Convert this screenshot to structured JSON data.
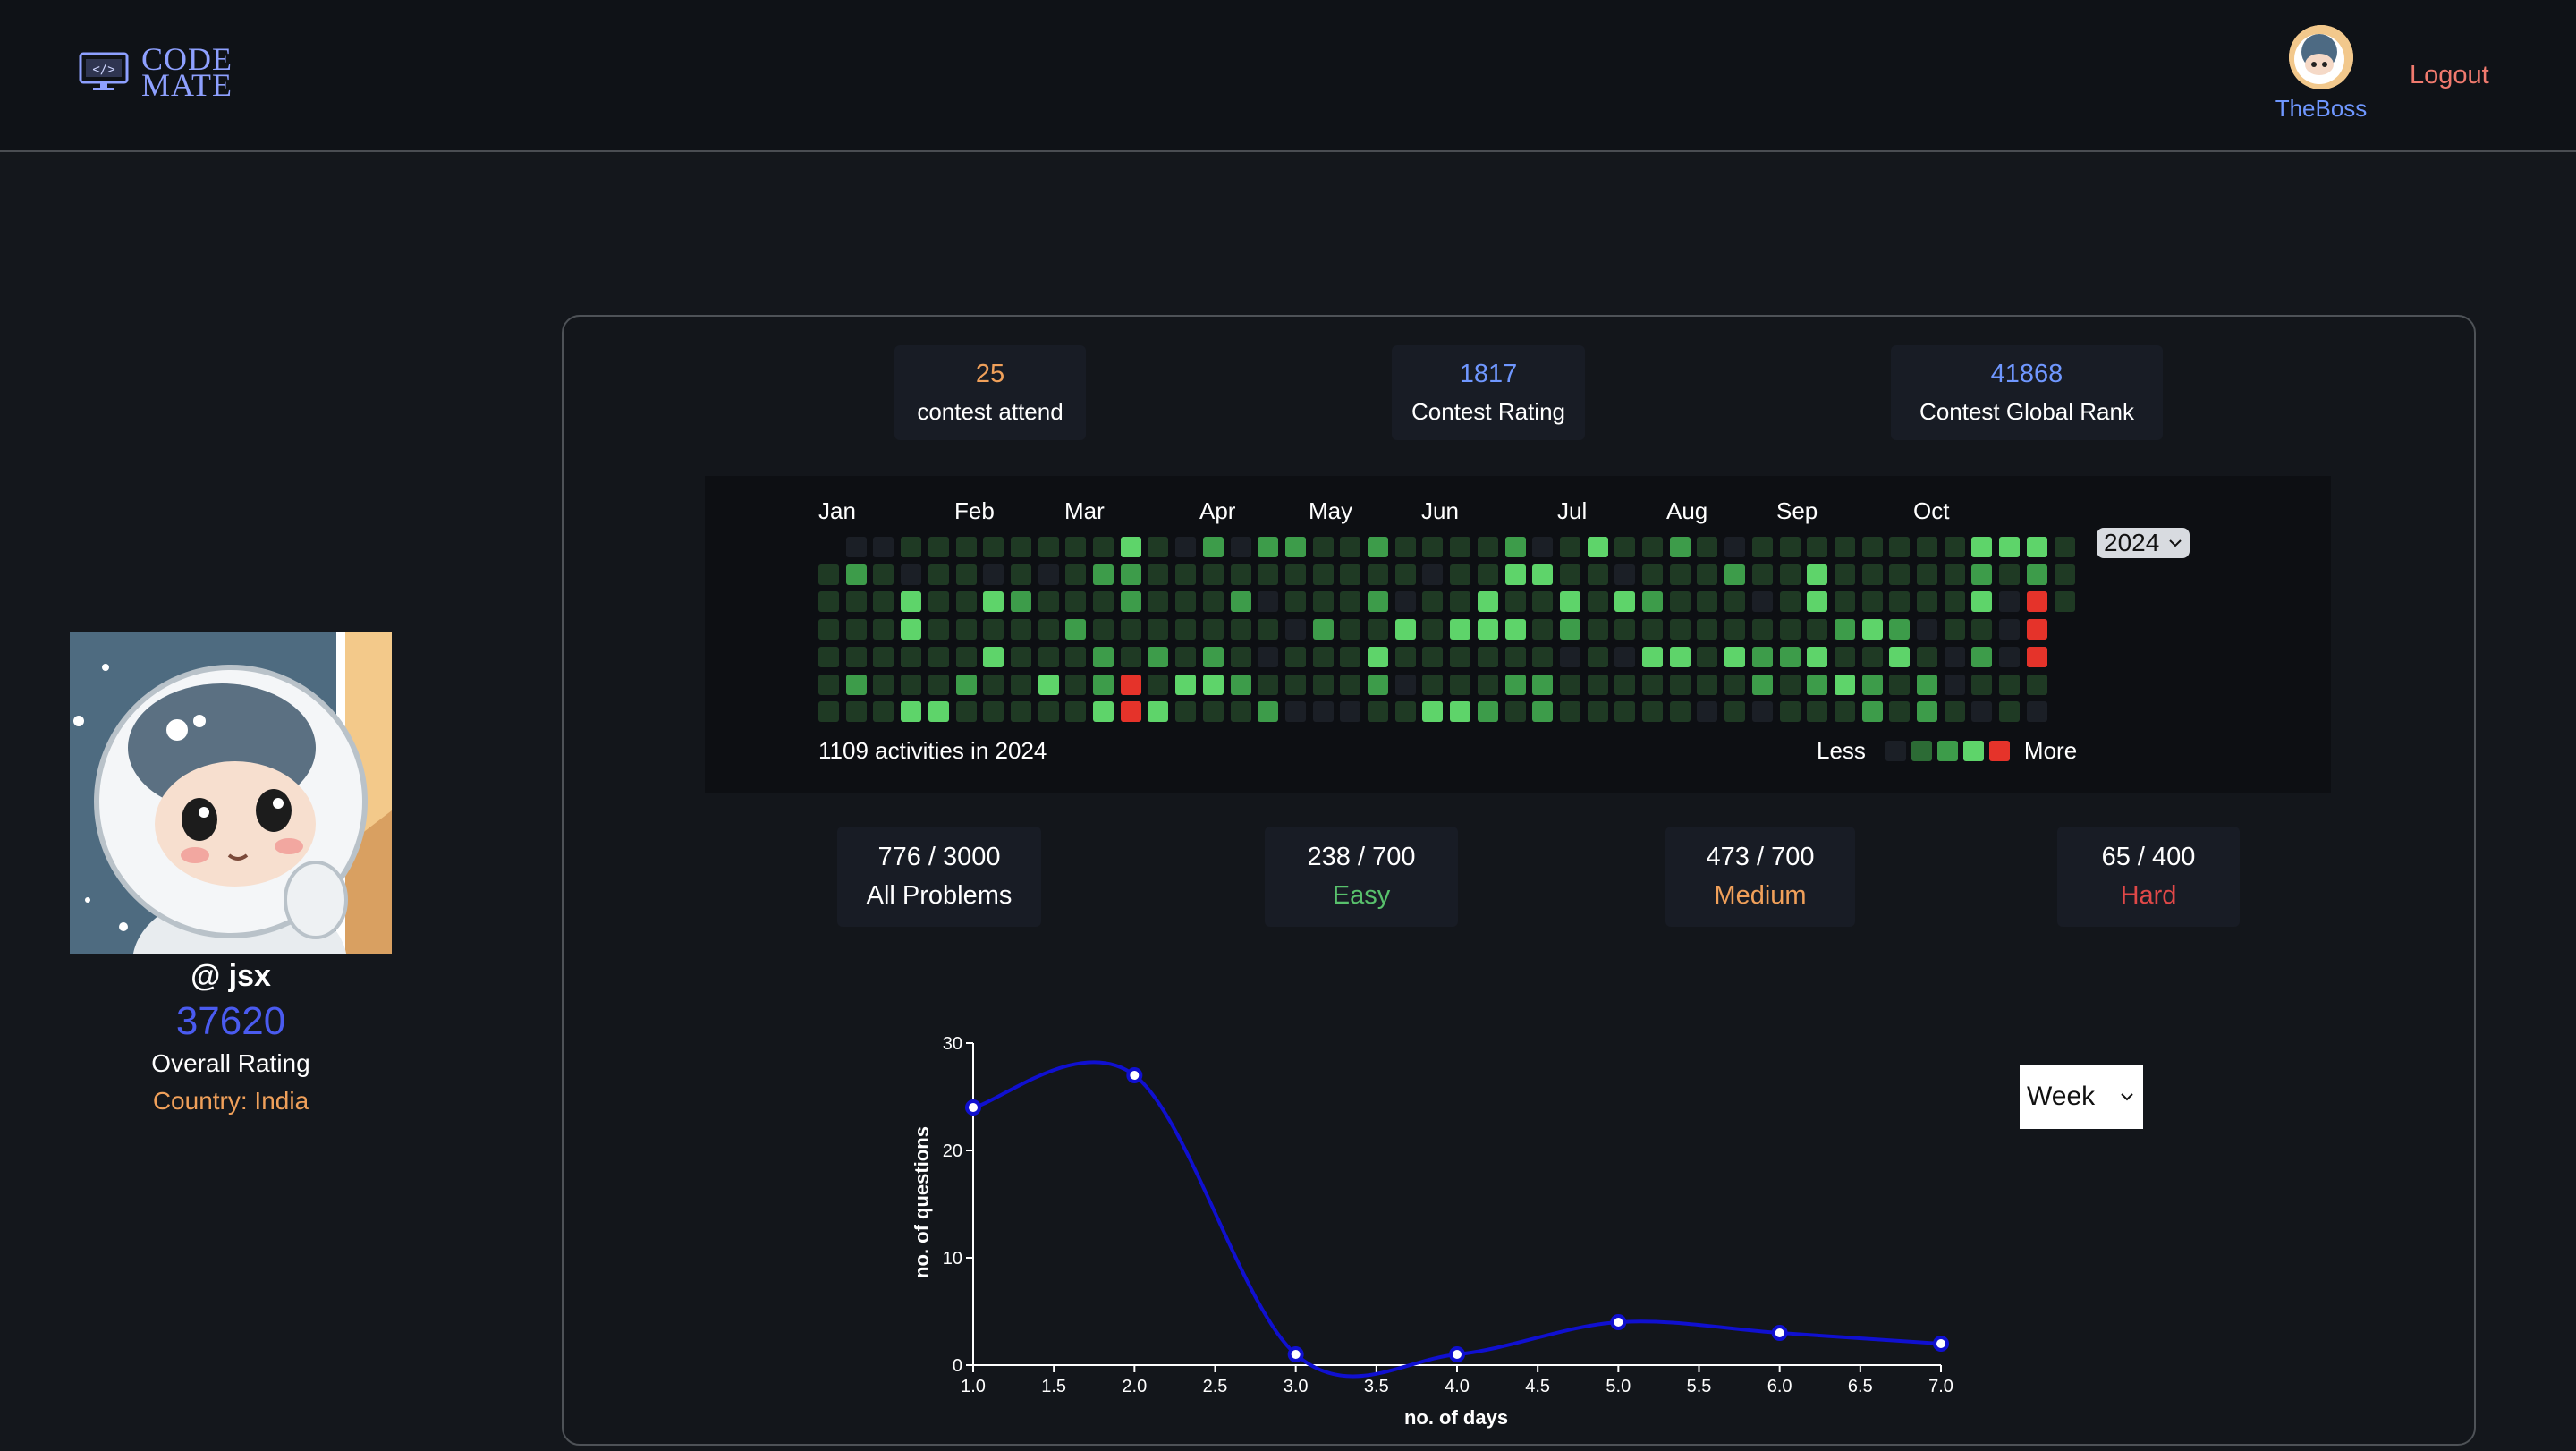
{
  "app": {
    "logo_line1": "CODE",
    "logo_line2": "MATE"
  },
  "nav": {
    "username": "TheBoss",
    "logout": "Logout"
  },
  "profile": {
    "handle": "@ jsx",
    "rating": "37620",
    "rating_label": "Overall Rating",
    "country": "Country: India"
  },
  "contest": {
    "stats": [
      {
        "value": "25",
        "label": "contest attend",
        "color": "#f0a05a"
      },
      {
        "value": "1817",
        "label": "Contest Rating",
        "color": "#6f97ff"
      },
      {
        "value": "41868",
        "label": "Contest Global Rank",
        "color": "#6f97ff"
      }
    ]
  },
  "heatmap": {
    "months": [
      "Jan",
      "Feb",
      "Mar",
      "Apr",
      "May",
      "Jun",
      "Jul",
      "Aug",
      "Sep",
      "Oct"
    ],
    "year": "2024",
    "summary": "1109 activities in 2024",
    "legend_less": "Less",
    "legend_more": "More",
    "levels_colors": [
      "#1b1f26",
      "#1f3a24",
      "#2c6b35",
      "#3d9c4a",
      "#5ed46a",
      "#e5332a"
    ]
  },
  "problems": [
    {
      "value": "776 / 3000",
      "label": "All Problems",
      "color": "#ffffff"
    },
    {
      "value": "238 / 700",
      "label": "Easy",
      "color": "#58c16c"
    },
    {
      "value": "473 / 700",
      "label": "Medium",
      "color": "#f0a05a"
    },
    {
      "value": "65 / 400",
      "label": "Hard",
      "color": "#e04848"
    }
  ],
  "period_select": {
    "value": "Week"
  },
  "chart_data": {
    "type": "line",
    "x": [
      1,
      2,
      3,
      4,
      5,
      6,
      7
    ],
    "series": [
      {
        "values": [
          24,
          27,
          1,
          1,
          4,
          3,
          2
        ],
        "color": "#1010d0"
      }
    ],
    "xlabel": "no. of days",
    "ylabel": "no. of questions",
    "xlim": [
      1,
      7
    ],
    "ylim": [
      0,
      30
    ],
    "xticks": [
      "1.0",
      "1.5",
      "2.0",
      "2.5",
      "3.0",
      "3.5",
      "4.0",
      "4.5",
      "5.0",
      "5.5",
      "6.0",
      "6.5",
      "7.0"
    ],
    "yticks": [
      "0",
      "10",
      "20",
      "30"
    ]
  }
}
